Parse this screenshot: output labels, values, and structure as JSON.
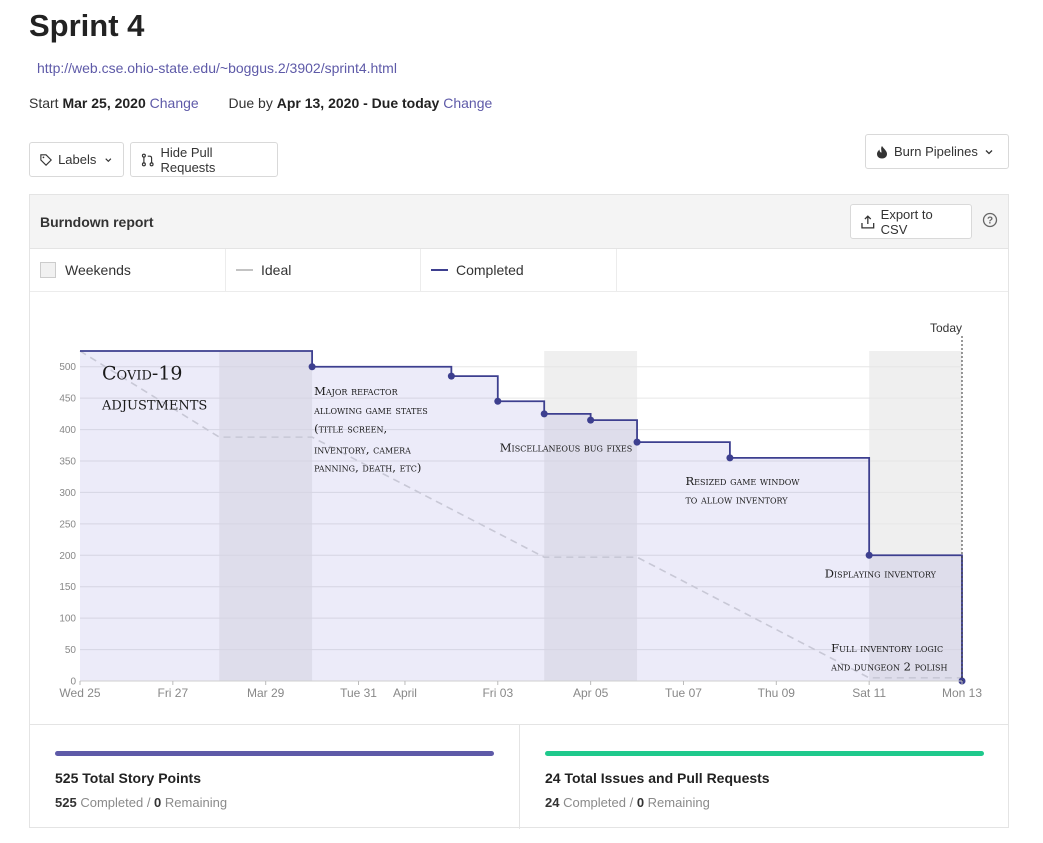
{
  "header": {
    "title": "Sprint 4",
    "url": "http://web.cse.ohio-state.edu/~boggus.2/3902/sprint4.html",
    "start_label": "Start",
    "start_date": "Mar 25, 2020",
    "change_label": "Change",
    "due_label": "Due by",
    "due_date": "Apr 13, 2020 - Due today"
  },
  "toolbar": {
    "labels_button": "Labels",
    "hide_pr_button": "Hide Pull Requests",
    "burn_pipelines_button": "Burn Pipelines"
  },
  "report": {
    "title": "Burndown report",
    "export_button": "Export to CSV",
    "legend": {
      "weekends": "Weekends",
      "ideal": "Ideal",
      "completed": "Completed"
    },
    "today_label": "Today"
  },
  "chart_data": {
    "type": "line",
    "title": "",
    "xlabel": "",
    "ylabel": "",
    "ylim": [
      0,
      525
    ],
    "yticks": [
      0,
      50,
      100,
      150,
      200,
      250,
      300,
      350,
      400,
      450,
      500
    ],
    "xticks": [
      {
        "label": "Wed 25",
        "date": "2020-03-25"
      },
      {
        "label": "Fri 27",
        "date": "2020-03-27"
      },
      {
        "label": "Mar 29",
        "date": "2020-03-29"
      },
      {
        "label": "Tue 31",
        "date": "2020-03-31"
      },
      {
        "label": "April",
        "date": "2020-04-01"
      },
      {
        "label": "Fri 03",
        "date": "2020-04-03"
      },
      {
        "label": "Apr 05",
        "date": "2020-04-05"
      },
      {
        "label": "Tue 07",
        "date": "2020-04-07"
      },
      {
        "label": "Thu 09",
        "date": "2020-04-09"
      },
      {
        "label": "Sat 11",
        "date": "2020-04-11"
      },
      {
        "label": "Mon 13",
        "date": "2020-04-13"
      }
    ],
    "weekends": [
      [
        "2020-03-28",
        "2020-03-30"
      ],
      [
        "2020-04-04",
        "2020-04-06"
      ],
      [
        "2020-04-11",
        "2020-04-13"
      ]
    ],
    "series": [
      {
        "name": "Completed",
        "color": "#3d3f8f",
        "points": [
          [
            "2020-03-25",
            525
          ],
          [
            "2020-03-30",
            500
          ],
          [
            "2020-04-02",
            485
          ],
          [
            "2020-04-03",
            445
          ],
          [
            "2020-04-04",
            425
          ],
          [
            "2020-04-05",
            415
          ],
          [
            "2020-04-06",
            380
          ],
          [
            "2020-04-08",
            355
          ],
          [
            "2020-04-11",
            200
          ],
          [
            "2020-04-13",
            0
          ]
        ]
      },
      {
        "name": "Ideal",
        "color": "#c8c8d6",
        "points": [
          [
            "2020-03-25",
            525
          ],
          [
            "2020-03-28",
            388
          ],
          [
            "2020-03-30",
            388
          ],
          [
            "2020-04-04",
            197
          ],
          [
            "2020-04-06",
            197
          ],
          [
            "2020-04-11",
            5
          ],
          [
            "2020-04-13",
            5
          ]
        ]
      }
    ],
    "annotations": [
      {
        "text": "Covid-19",
        "date": "2020-03-25",
        "y": 480
      },
      {
        "text": "adjustments",
        "date": "2020-03-25",
        "y": 432
      },
      {
        "text": "Major refactor",
        "date": "2020-03-30",
        "y": 455
      },
      {
        "text": "allowing game states",
        "date": "2020-03-30",
        "y": 425
      },
      {
        "text": "(title screen,",
        "date": "2020-03-30",
        "y": 395
      },
      {
        "text": "inventory, camera",
        "date": "2020-03-30",
        "y": 362
      },
      {
        "text": "panning, death, etc)",
        "date": "2020-03-30",
        "y": 333
      },
      {
        "text": "Miscellaneous bug fixes",
        "date": "2020-04-03",
        "y": 365
      },
      {
        "text": "Resized game window",
        "date": "2020-04-07",
        "y": 312
      },
      {
        "text": "to allow inventory",
        "date": "2020-04-07",
        "y": 282
      },
      {
        "text": "Displaying inventory",
        "date": "2020-04-10",
        "y": 165
      },
      {
        "text": "Full inventory logic",
        "date": "2020-04-11",
        "y": 46
      },
      {
        "text": "and dungeon 2 polish",
        "date": "2020-04-11",
        "y": 17
      }
    ]
  },
  "stats": [
    {
      "title": "525 Total Story Points",
      "completed": "525",
      "completed_label": "Completed",
      "remaining": "0",
      "remaining_label": "Remaining",
      "color": "#5e5aa8"
    },
    {
      "title": "24 Total Issues and Pull Requests",
      "completed": "24",
      "completed_label": "Completed",
      "remaining": "0",
      "remaining_label": "Remaining",
      "color": "#1fc98c"
    }
  ]
}
